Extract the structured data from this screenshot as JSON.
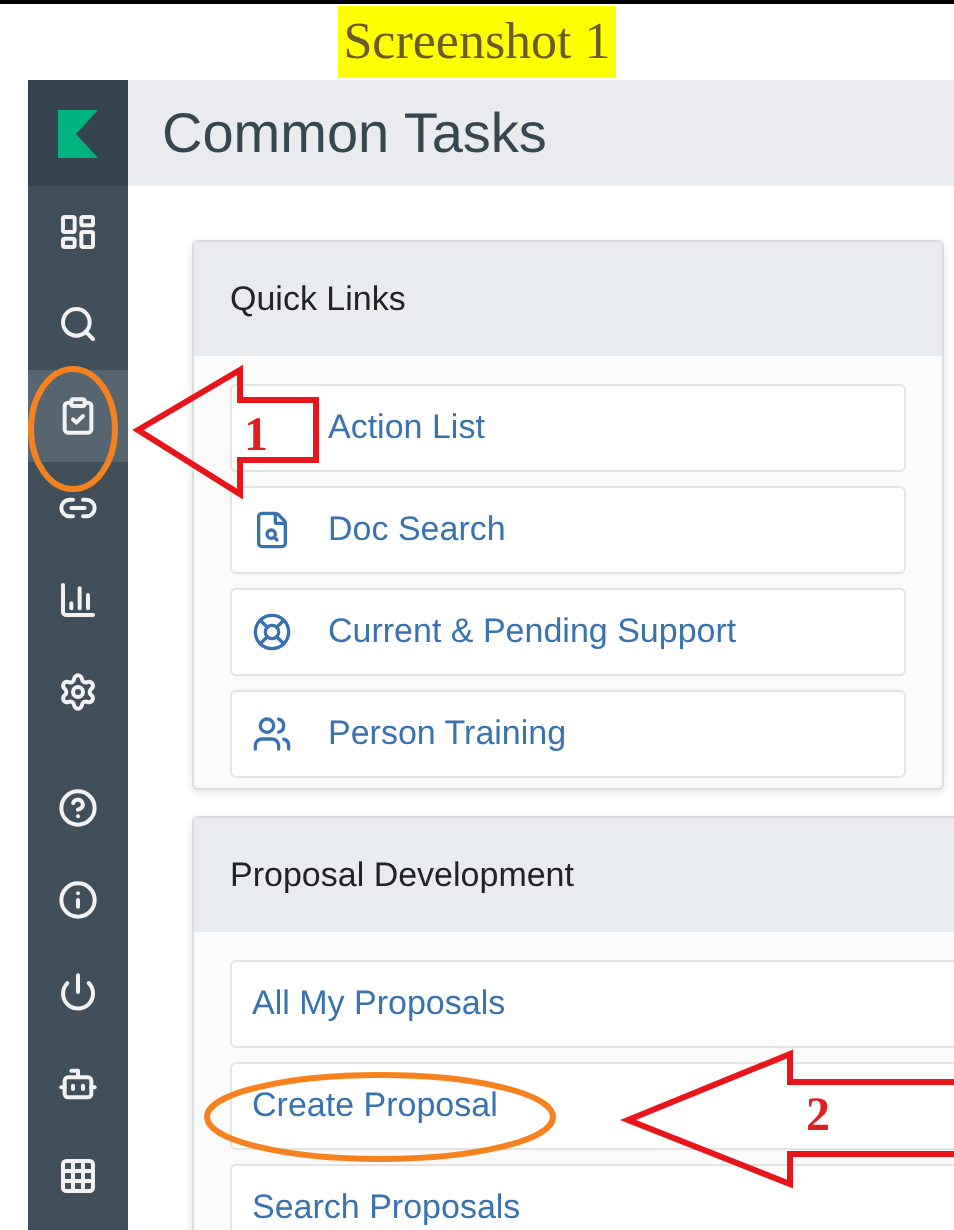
{
  "caption": "Screenshot 1",
  "sidebar": {
    "items": [
      {
        "selected": false
      },
      {
        "selected": false
      },
      {
        "selected": true
      },
      {
        "selected": false
      },
      {
        "selected": false
      },
      {
        "selected": false
      },
      {
        "selected": false
      },
      {
        "selected": false
      },
      {
        "selected": false
      },
      {
        "selected": false
      },
      {
        "selected": false
      }
    ]
  },
  "header": {
    "title": "Common Tasks"
  },
  "cards": [
    {
      "title": "Quick Links",
      "links": [
        {
          "label": "Action List"
        },
        {
          "label": "Doc Search"
        },
        {
          "label": "Current & Pending Support"
        },
        {
          "label": "Person Training"
        }
      ]
    },
    {
      "title": "Proposal Development",
      "links": [
        {
          "label": "All My Proposals"
        },
        {
          "label": "Create Proposal"
        },
        {
          "label": "Search Proposals"
        }
      ]
    }
  ],
  "annotations": [
    {
      "label": "1"
    },
    {
      "label": "2"
    }
  ]
}
